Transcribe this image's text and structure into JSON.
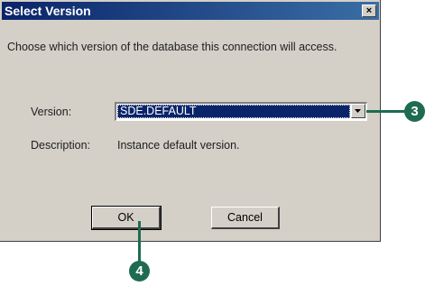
{
  "dialog": {
    "title": "Select Version",
    "close_glyph": "×",
    "instruction": "Choose which version of the database this connection will access.",
    "version_label": "Version:",
    "version_value": "SDE.DEFAULT",
    "description_label": "Description:",
    "description_value": "Instance default version.",
    "ok_label": "OK",
    "cancel_label": "Cancel"
  },
  "callouts": {
    "step_3": "3",
    "step_4": "4"
  },
  "colors": {
    "titlebar": "#0a246a",
    "callout": "#1f6b52",
    "dialog_bg": "#d4d0c8"
  },
  "icons": {
    "close": "close-icon",
    "dropdown": "chevron-down-icon"
  }
}
